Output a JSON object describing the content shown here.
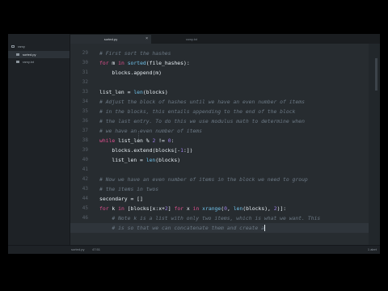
{
  "sidebar": {
    "items": [
      {
        "label": "ramy",
        "icon": "folder-icon"
      },
      {
        "label": "sorted.py",
        "icon": "file-icon"
      },
      {
        "label": "ramy.txt",
        "icon": "file-icon"
      }
    ]
  },
  "tabs": [
    {
      "label": "sorted.py"
    },
    {
      "label": "ramy.txt"
    }
  ],
  "editor": {
    "line_numbers": [
      "29",
      "30",
      "31",
      "32",
      "33",
      "34",
      "35",
      "36",
      "37",
      "38",
      "39",
      "40",
      "41",
      "42",
      "43",
      "44",
      "45",
      "46",
      "47"
    ],
    "current_line": "47",
    "code": [
      "# First sort the hashes",
      "for m in sorted(file_hashes):",
      "    blocks.append(m)",
      "",
      "list_len = len(blocks)",
      "# Adjust the block of hashes until we have an even number of items",
      "# in the blocks, this entails appending to the end of the block",
      "# the last entry. To do this we use modulus math to determine when",
      "# we have an even number of items",
      "while list_len % 2 != 0:",
      "    blocks.extend(blocks[-1:])",
      "    list_len = len(blocks)",
      "",
      "# Now we have an even number of items in the block we need to group",
      "# the items in twos",
      "secondary = []",
      "for k in [blocks[x:x+2] for x in xrange(0, len(blocks), 2)]:",
      "    # Note k is a list with only two items, which is what we want. This",
      "    # is so that we can concatenate them and create a"
    ]
  },
  "statusbar": {
    "file": "sorted.py",
    "position": "47:51",
    "right": "1 alert"
  },
  "colors": {
    "keyword": "#e0508f",
    "builtin": "#6fc0e8",
    "number": "#9d7ee6",
    "comment": "#6d7a86",
    "text": "#e6edf2"
  }
}
